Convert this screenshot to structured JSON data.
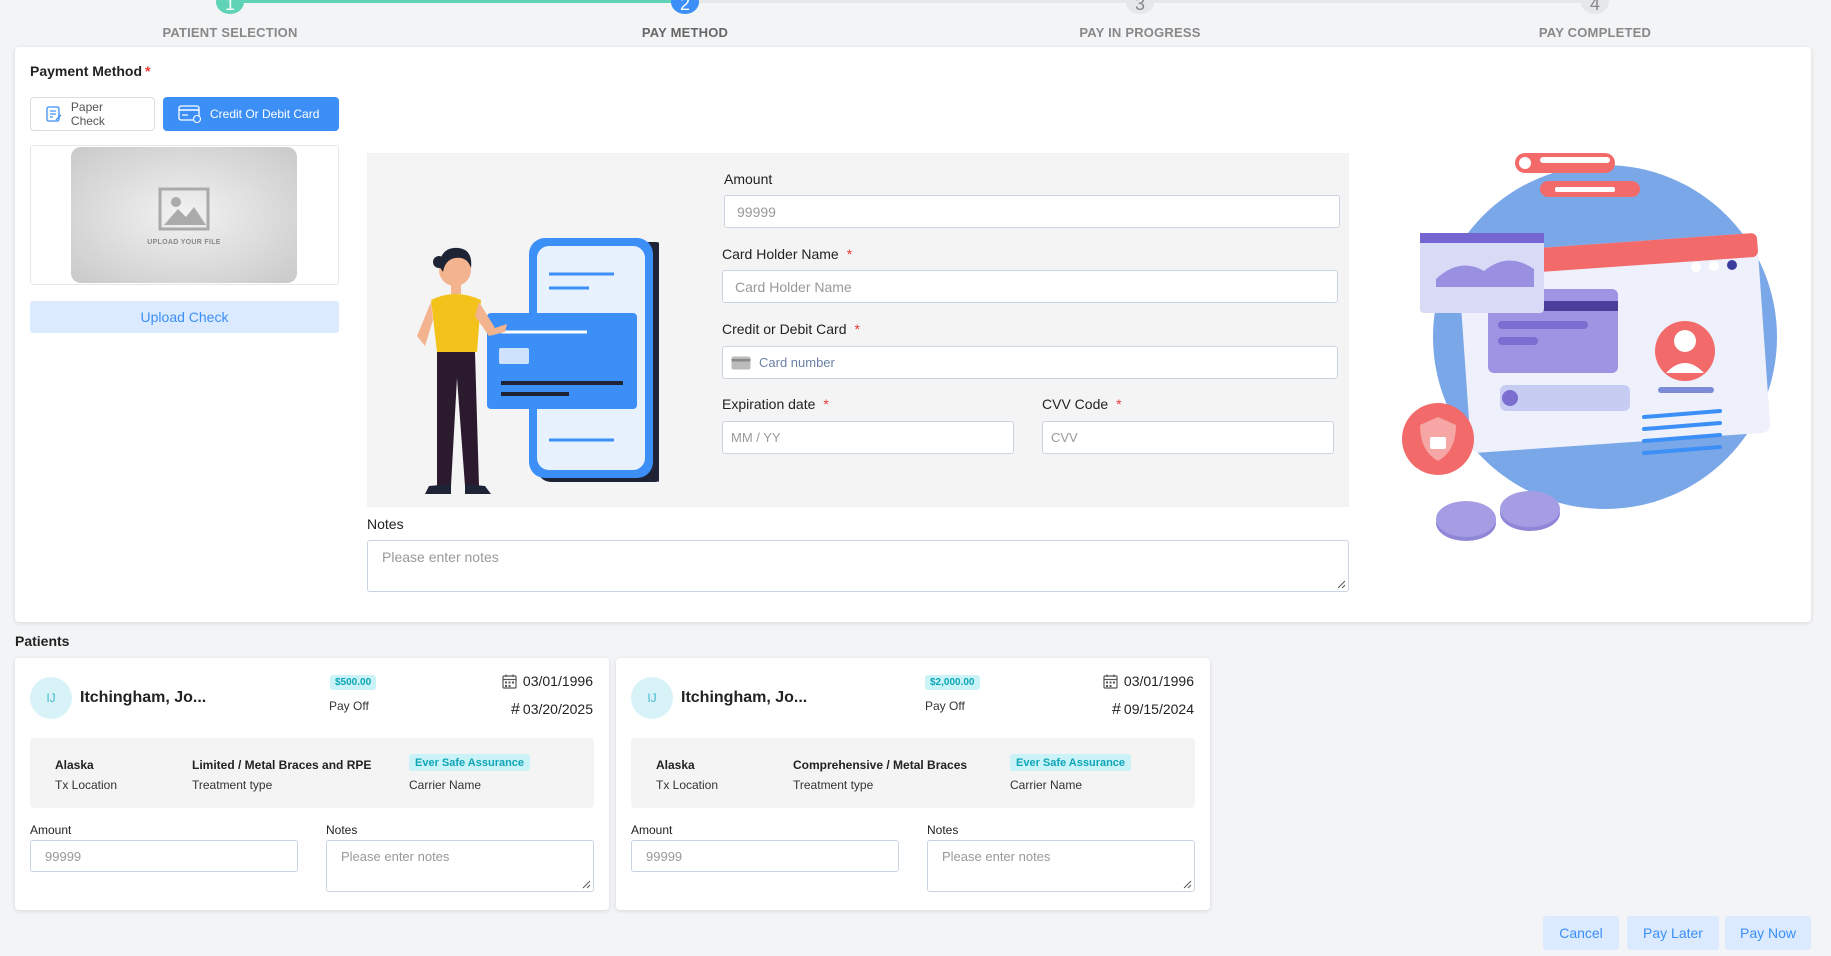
{
  "stepper": {
    "steps": [
      {
        "number": "1",
        "label": "PATIENT SELECTION"
      },
      {
        "number": "2",
        "label": "PAY METHOD"
      },
      {
        "number": "3",
        "label": "PAY IN PROGRESS"
      },
      {
        "number": "4",
        "label": "PAY COMPLETED"
      }
    ]
  },
  "payment_method": {
    "title": "Payment Method",
    "required_mark": "*",
    "options": [
      {
        "label": "Paper Check",
        "icon": "paper-check-icon"
      },
      {
        "label": "Credit Or Debit Card",
        "icon": "credit-card-icon"
      }
    ],
    "selected": "Credit Or Debit Card",
    "upload_placeholder": "UPLOAD YOUR FILE",
    "upload_button": "Upload Check"
  },
  "form": {
    "amount_label": "Amount",
    "amount_placeholder": "99999",
    "holder_label": "Card Holder Name",
    "holder_placeholder": "Card Holder Name",
    "card_label": "Credit or Debit Card",
    "card_placeholder": "Card number",
    "exp_label": "Expiration date",
    "exp_placeholder": "MM / YY",
    "cvv_label": "CVV Code",
    "cvv_placeholder": "CVV",
    "notes_label": "Notes",
    "notes_placeholder": "Please enter notes"
  },
  "patients": {
    "title": "Patients",
    "cards": [
      {
        "initials": "IJ",
        "name": "Itchingham, Jo...",
        "amount_badge": "$500.00",
        "payoff": "Pay Off",
        "dob": "03/01/1996",
        "hash": "#",
        "date": "03/20/2025",
        "location": "Alaska",
        "location_label": "Tx Location",
        "treatment": "Limited / Metal Braces and RPE",
        "treatment_label": "Treatment type",
        "carrier": "Ever Safe Assurance",
        "carrier_label": "Carrier Name",
        "amount_label": "Amount",
        "amount_placeholder": "99999",
        "notes_label": "Notes",
        "notes_placeholder": "Please enter notes"
      },
      {
        "initials": "IJ",
        "name": "Itchingham, Jo...",
        "amount_badge": "$2,000.00",
        "payoff": "Pay Off",
        "dob": "03/01/1996",
        "hash": "#",
        "date": "09/15/2024",
        "location": "Alaska",
        "location_label": "Tx Location",
        "treatment": "Comprehensive / Metal Braces",
        "treatment_label": "Treatment type",
        "carrier": "Ever Safe Assurance",
        "carrier_label": "Carrier Name",
        "amount_label": "Amount",
        "amount_placeholder": "99999",
        "notes_label": "Notes",
        "notes_placeholder": "Please enter notes"
      }
    ]
  },
  "footer": {
    "cancel": "Cancel",
    "pay_later": "Pay Later",
    "pay_now": "Pay Now"
  },
  "colors": {
    "primary": "#3b8ff6",
    "step_done": "#5fd3b5",
    "badge_bg": "#c9f3f6",
    "badge_text": "#0ea5b8",
    "required": "#e53935"
  }
}
